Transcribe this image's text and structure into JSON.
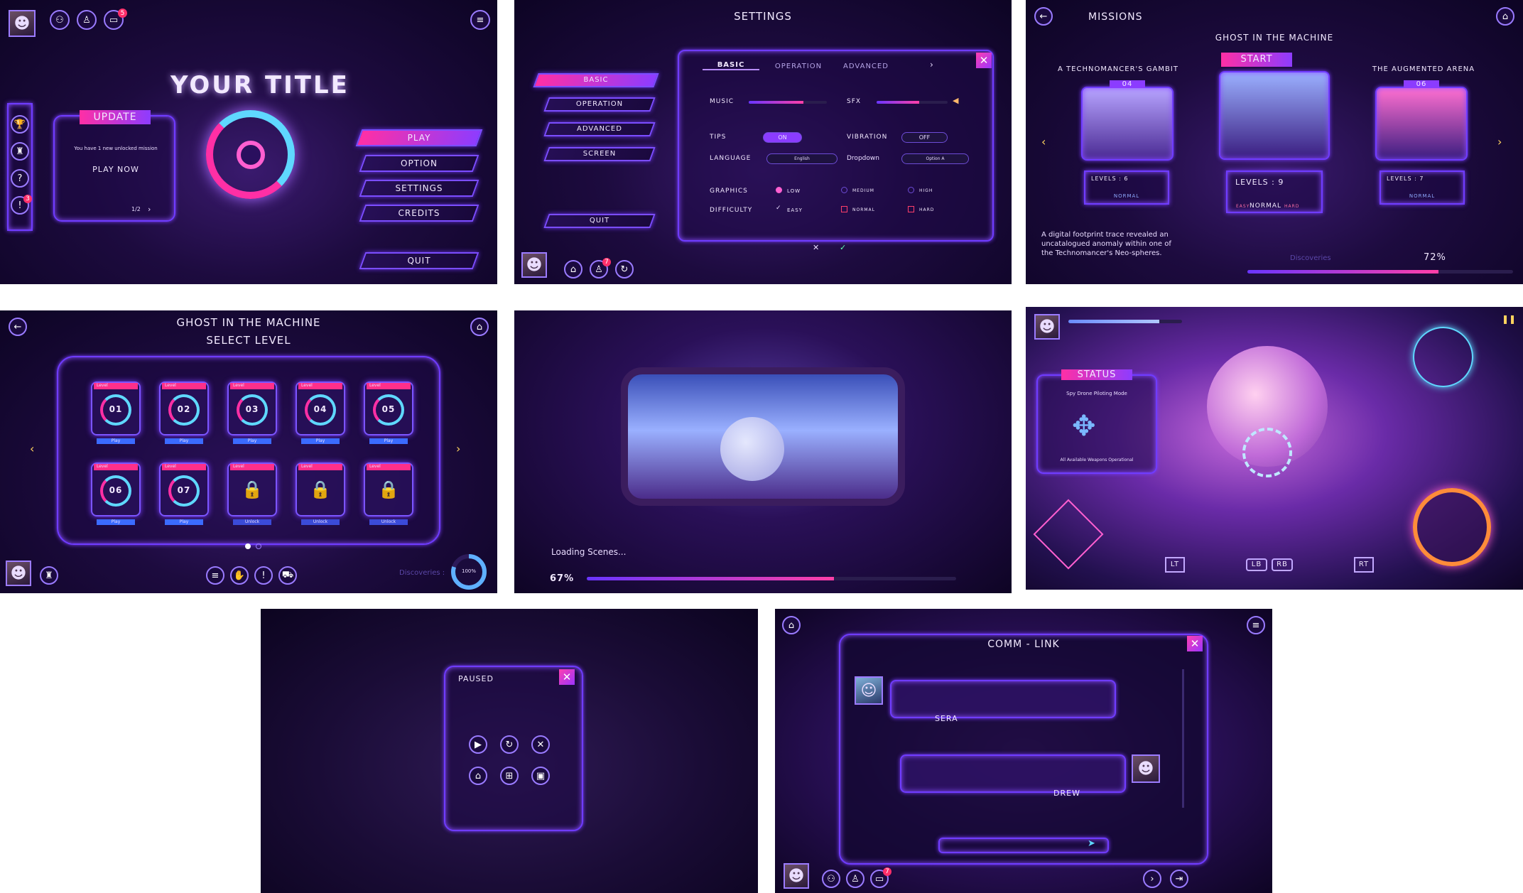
{
  "main_menu": {
    "title": "YOUR TITLE",
    "update": {
      "label": "UPDATE",
      "message": "You have 1 new unlocked mission",
      "cta": "PLAY NOW",
      "pager": "1/2"
    },
    "buttons": [
      "PLAY",
      "OPTION",
      "SETTINGS",
      "CREDITS",
      "QUIT"
    ],
    "badges": {
      "chat": "5",
      "alert": "3"
    },
    "icons": {
      "left_rail": [
        "trophy-icon",
        "rank-icon",
        "help-icon",
        "alert-icon"
      ],
      "top": [
        "party-icon",
        "profile-icon",
        "chat-icon",
        "menu-icon"
      ]
    }
  },
  "settings": {
    "title": "SETTINGS",
    "side_buttons": [
      "BASIC",
      "OPERATION",
      "ADVANCED",
      "SCREEN"
    ],
    "quit": "QUIT",
    "tabs": [
      "BASIC",
      "OPERATION",
      "ADVANCED"
    ],
    "labels": {
      "music": "MUSIC",
      "sfx": "SFX",
      "tips": "TIPS",
      "vibration": "VIBRATION",
      "language": "LANGUAGE",
      "dropdown": "Dropdown",
      "graphics": "GRAPHICS",
      "difficulty": "DIFFICULTY"
    },
    "values": {
      "music": 0.7,
      "sfx": 0.6,
      "tips": "ON",
      "vibration": "OFF",
      "language": "English",
      "dropdown": "Option A"
    },
    "graphics_options": [
      "LOW",
      "MEDIUM",
      "HIGH"
    ],
    "difficulty_options": [
      "EASY",
      "NORMAL",
      "HARD"
    ],
    "selected": {
      "graphics": "LOW",
      "difficulty": "EASY"
    },
    "badge": "7"
  },
  "missions": {
    "title": "MISSIONS",
    "featured": "GHOST IN THE MACHINE",
    "start": "START",
    "cards": [
      {
        "name": "A TECHNOMANCER'S GAMBIT",
        "num": "04",
        "levels": "LEVELS : 6",
        "mode": "NORMAL"
      },
      {
        "name": "",
        "num": "",
        "levels": "LEVELS : 9",
        "mode": "NORMAL",
        "modes": [
          "EASY",
          "NORMAL",
          "HARD"
        ]
      },
      {
        "name": "THE AUGMENTED ARENA",
        "num": "06",
        "levels": "LEVELS : 7",
        "mode": "NORMAL"
      }
    ],
    "description": "A digital footprint trace revealed an uncatalogued anomaly  within one of the Technomancer's Neo-spheres.",
    "discoveries_label": "Discoveries",
    "discoveries_value": "72%",
    "discoveries_fraction": 0.72
  },
  "level_select": {
    "title": "GHOST IN THE MACHINE",
    "subtitle": "SELECT LEVEL",
    "tag": "Level",
    "levels": [
      {
        "num": "01",
        "action": "Play"
      },
      {
        "num": "02",
        "action": "Play"
      },
      {
        "num": "03",
        "action": "Play"
      },
      {
        "num": "04",
        "action": "Play"
      },
      {
        "num": "05",
        "action": "Play"
      },
      {
        "num": "06",
        "action": "Play"
      },
      {
        "num": "07",
        "action": "Play"
      },
      {
        "num": "",
        "action": "Unlock"
      },
      {
        "num": "",
        "action": "Unlock"
      },
      {
        "num": "",
        "action": "Unlock"
      }
    ],
    "discoveries_label": "Discoveries :",
    "discoveries_value": "100%",
    "discoveries_fraction": 0.8
  },
  "loading": {
    "text": "Loading Scenes...",
    "percent": "67%",
    "fraction": 0.67
  },
  "hud": {
    "status": "STATUS",
    "mode": "Spy Drone Piloting Mode",
    "weapons": "All Available Weapons Operational",
    "buttons": [
      "LT",
      "LB",
      "RB",
      "RT"
    ]
  },
  "paused": {
    "title": "PAUSED",
    "icons": [
      "play-icon",
      "restart-icon",
      "close-icon",
      "home-icon",
      "grid-icon",
      "save-icon"
    ]
  },
  "comm": {
    "title": "COMM - LINK",
    "speaker1": "SERA",
    "speaker2": "DREW",
    "badge": "7"
  }
}
